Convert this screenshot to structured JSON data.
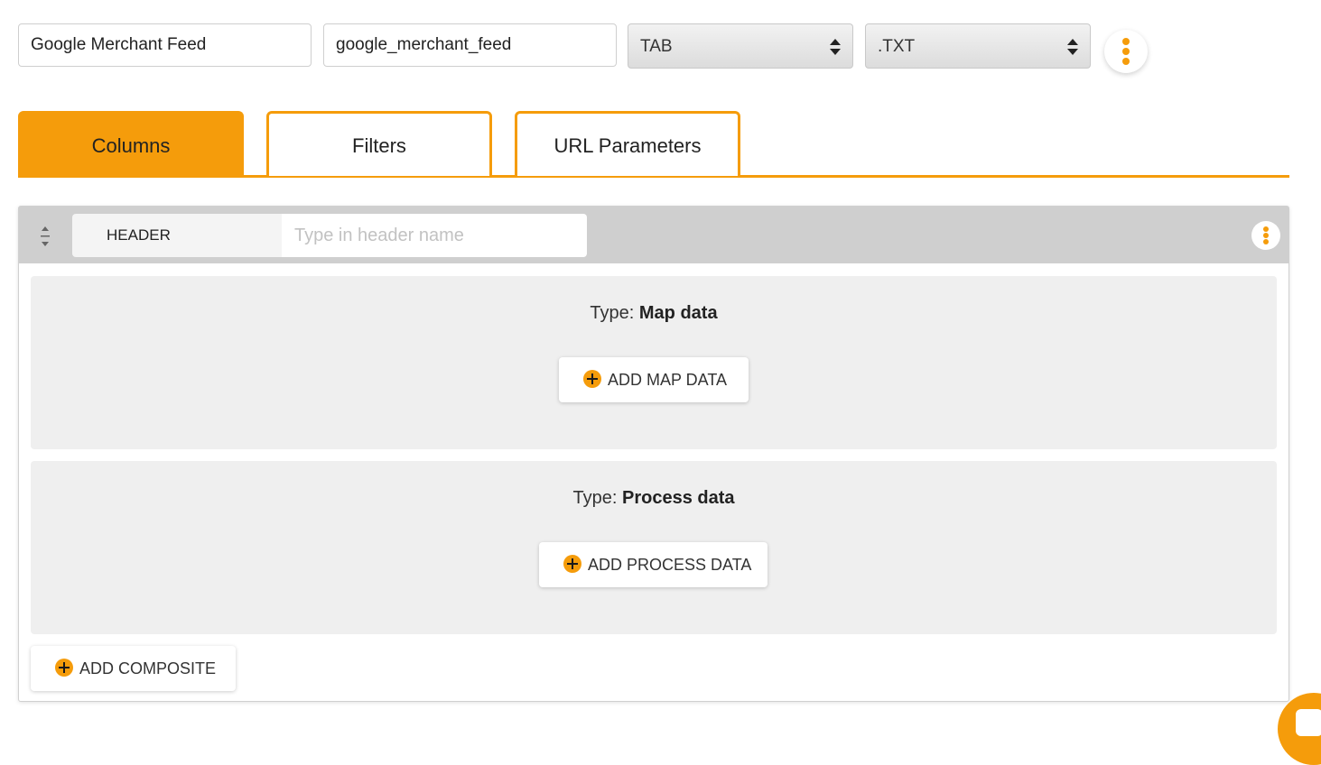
{
  "toolbar": {
    "feed_name": "Google Merchant Feed",
    "feed_slug": "google_merchant_feed",
    "delimiter": "TAB",
    "extension": ".TXT"
  },
  "tabs": [
    {
      "label": "Columns",
      "active": true
    },
    {
      "label": "Filters",
      "active": false
    },
    {
      "label": "URL Parameters",
      "active": false
    }
  ],
  "column": {
    "header_label": "HEADER",
    "header_placeholder": "Type in header name",
    "sections": [
      {
        "type_prefix": "Type:",
        "type_name": "Map data",
        "button": "ADD MAP DATA"
      },
      {
        "type_prefix": "Type:",
        "type_name": "Process data",
        "button": "ADD PROCESS DATA"
      }
    ],
    "add_composite": "ADD COMPOSITE"
  },
  "colors": {
    "accent": "#f59c0b",
    "header_bar": "#cfcfcf",
    "section_bg": "#efefef"
  },
  "icons": [
    "sort-arrows-icon",
    "kebab-menu-icon",
    "plus-circle-icon"
  ]
}
